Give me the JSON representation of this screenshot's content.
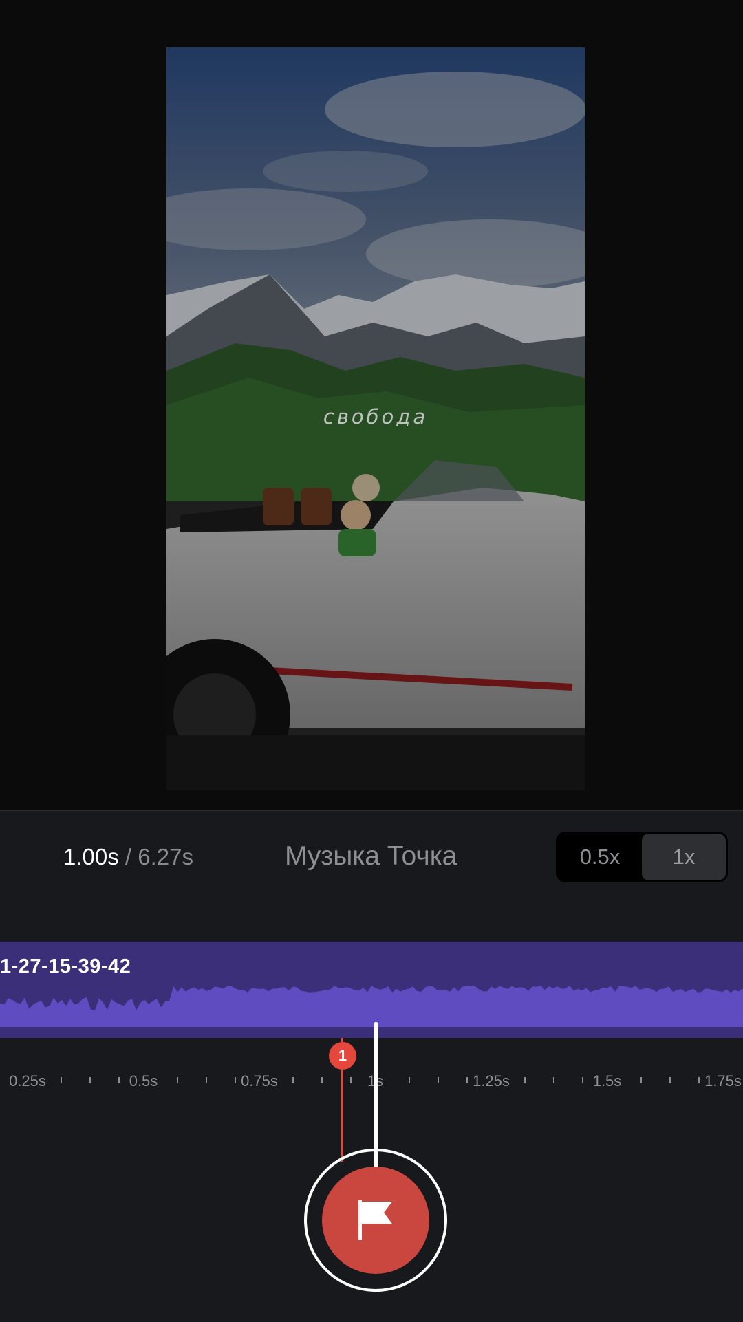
{
  "preview": {
    "overlay_text": "свобода",
    "icon": "video-preview"
  },
  "controls": {
    "current_time_value": "1.00",
    "current_time_unit": "s",
    "separator": "/",
    "total_time": "6.27s",
    "track_title": "Музыка Точка",
    "speed_options": [
      "0.5x",
      "1x"
    ],
    "selected_speed": "1x"
  },
  "timeline": {
    "audio_clip_label": "1-27-15-39-42",
    "marker_number": "1",
    "ruler_labels": [
      "0.25s",
      "0.5s",
      "0.75s",
      "1s",
      "1.25s",
      "1.5s",
      "1.75s"
    ],
    "playhead_time_s": 1.0,
    "marker_time_s": 0.86
  },
  "actions": {
    "add_marker_icon": "flag-icon"
  },
  "colors": {
    "accent_red": "#e5473d",
    "audio_track": "#3a2f78",
    "waveform": "#5f4cc1",
    "panel_bg": "#18191c"
  }
}
